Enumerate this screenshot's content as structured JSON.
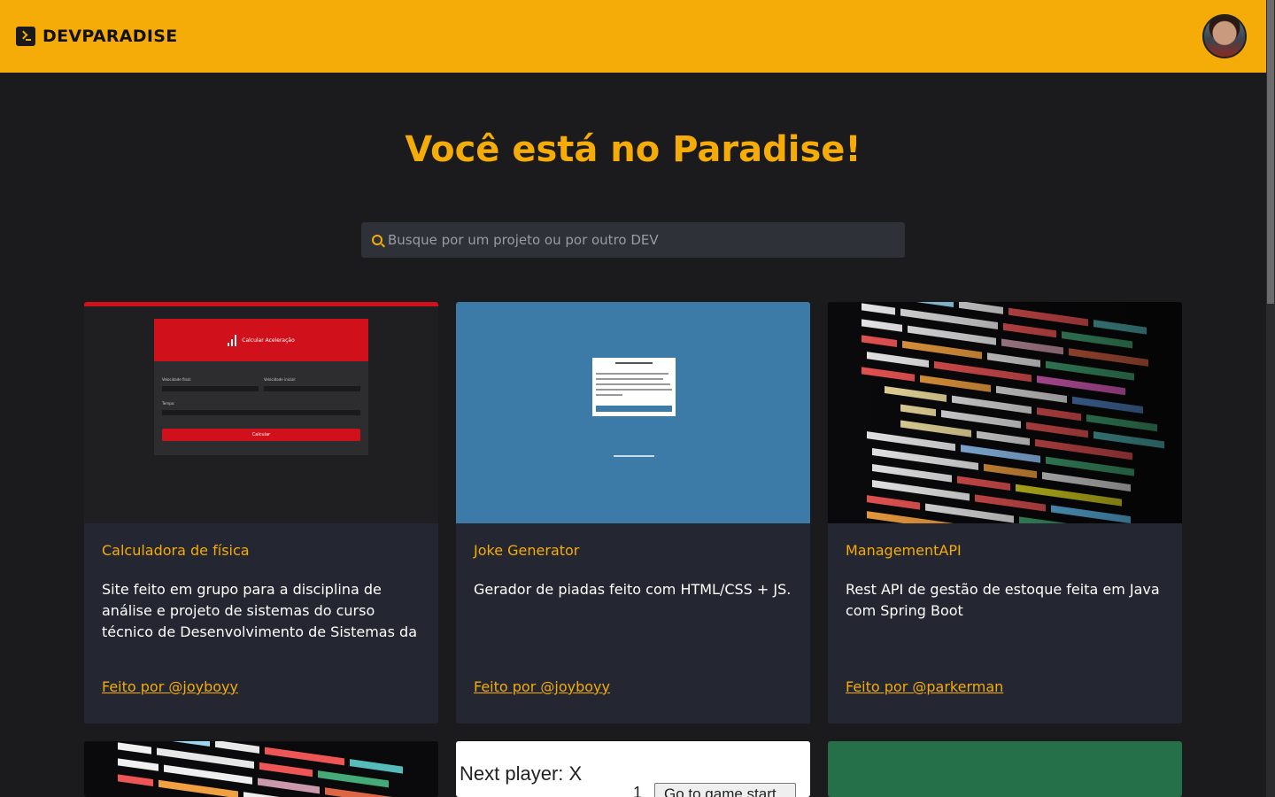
{
  "header": {
    "brand_name": "DEVPARADISE",
    "brand_icon": "terminal-icon",
    "avatar_icon": "user-avatar"
  },
  "hero": {
    "title": "Você está no Paradise!"
  },
  "search": {
    "placeholder": "Busque por um projeto ou por outro DEV",
    "value": ""
  },
  "colors": {
    "accent": "#f5ab08",
    "background": "#1b1b1d",
    "card": "#242731",
    "header": "#f5ab08"
  },
  "projects": [
    {
      "title": "Calculadora de física",
      "description": "Site feito em grupo para a disciplina de análise e projeto de sistemas do curso técnico de Desenvolvimento de Sistemas da",
      "author": "Feito por @joyboyy",
      "thumbnail": {
        "header": "Calcular Aceleração",
        "field_1": "Velocidade final:",
        "field_2": "Velocidade inicial:",
        "field_3": "Tempo:",
        "button": "Calcular"
      }
    },
    {
      "title": "Joke Generator",
      "description": "Gerador de piadas feito com HTML/CSS + JS.",
      "author": "Feito por @joyboyy"
    },
    {
      "title": "ManagementAPI",
      "description": "Rest API de gestão de estoque feita em Java com Spring Boot",
      "author": "Feito por @parkerman"
    }
  ],
  "partial_cards": [
    {
      "thumbnail": "code-image"
    },
    {
      "thumbnail": {
        "status": "Next player: X",
        "move_number": "1",
        "button": "Go to game start"
      }
    },
    {
      "thumbnail": "green-image"
    }
  ]
}
